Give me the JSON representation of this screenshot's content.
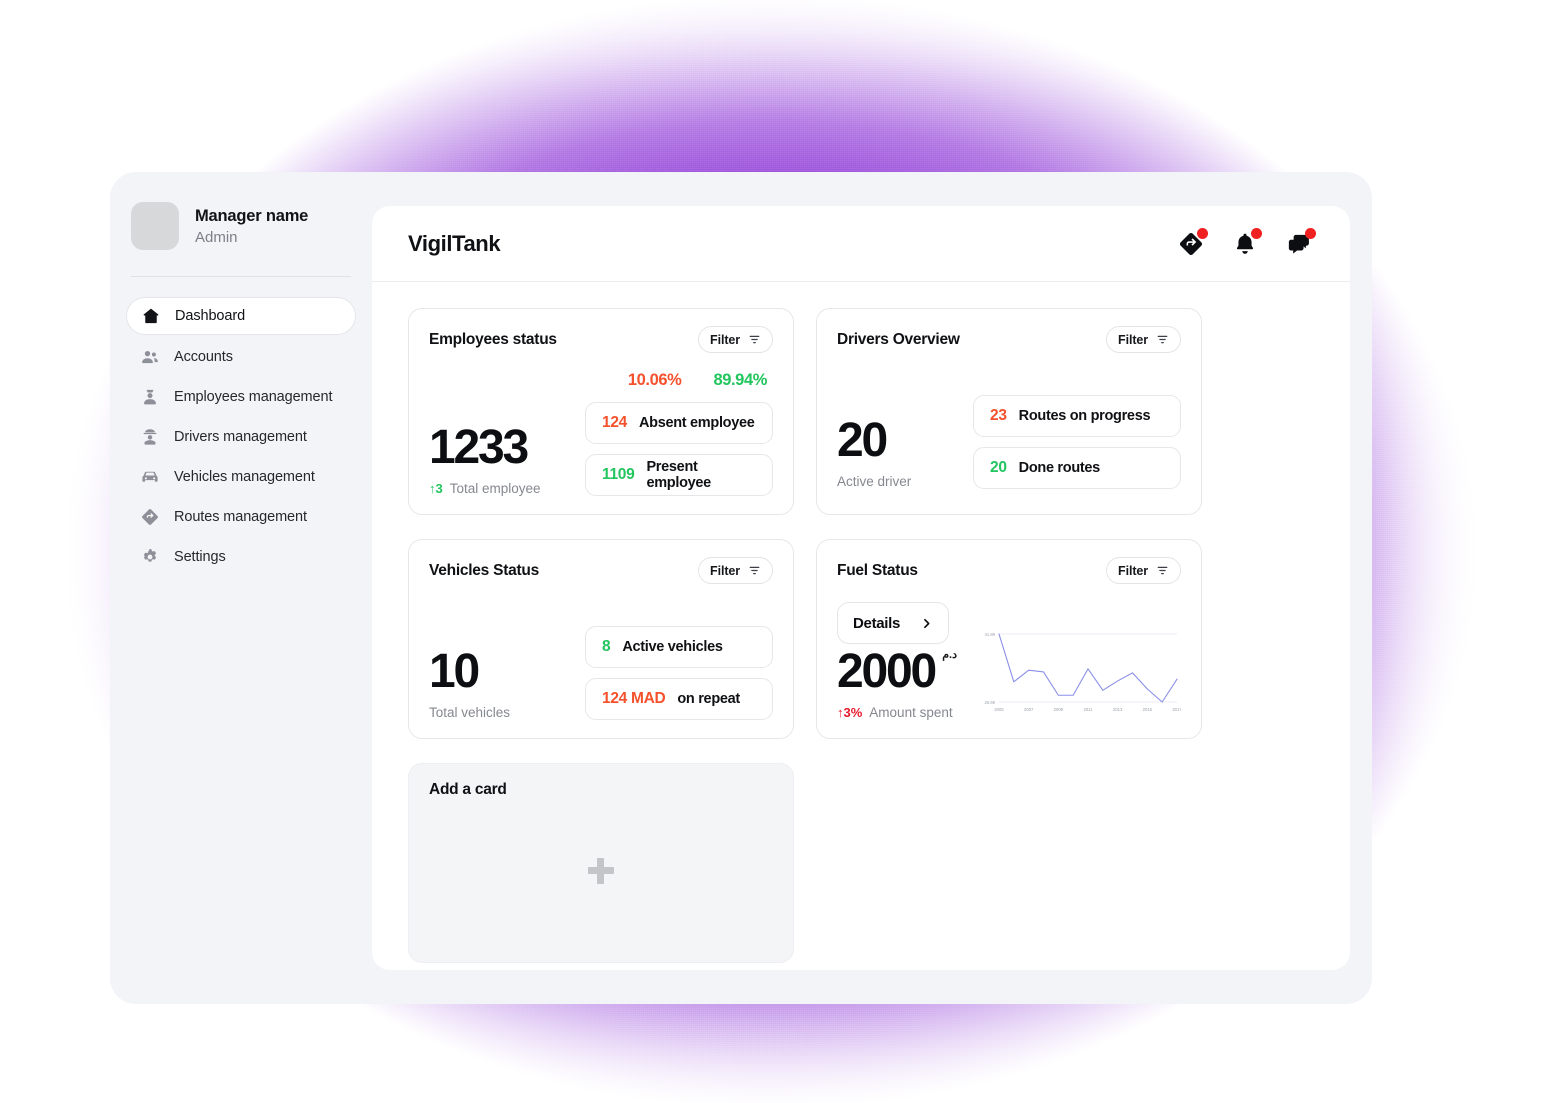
{
  "glow": {
    "color": "#8b33d6"
  },
  "sidebar": {
    "profile": {
      "name": "Manager name",
      "role": "Admin",
      "avatar_icon": "avatar-placeholder"
    },
    "items": [
      {
        "label": "Dashboard",
        "icon": "home-icon",
        "active": true
      },
      {
        "label": "Accounts",
        "icon": "people-icon",
        "active": false
      },
      {
        "label": "Employees management",
        "icon": "employee-badge-icon",
        "active": false
      },
      {
        "label": "Drivers management",
        "icon": "driver-cap-icon",
        "active": false
      },
      {
        "label": "Vehicles management",
        "icon": "car-icon",
        "active": false
      },
      {
        "label": "Routes management",
        "icon": "route-diamond-icon",
        "active": false
      },
      {
        "label": "Settings",
        "icon": "gear-icon",
        "active": false
      }
    ]
  },
  "topbar": {
    "brand": "VigilTank",
    "icons": [
      {
        "name": "routes-share-icon",
        "badge": true
      },
      {
        "name": "bell-icon",
        "badge": true
      },
      {
        "name": "chat-icon",
        "badge": true
      }
    ]
  },
  "filter_label": "Filter",
  "cards": {
    "employees": {
      "title": "Employees status",
      "filter": "Filter",
      "big_number": "1233",
      "delta": "↑3",
      "sub_label": "Total employee",
      "pct_absent": "10.06%",
      "pct_present": "89.94%",
      "absent": {
        "count": "124",
        "label": "Absent employee",
        "color": "#f4512c"
      },
      "present": {
        "count": "1109",
        "label": "Present employee",
        "color": "#22c55e"
      }
    },
    "drivers": {
      "title": "Drivers Overview",
      "filter": "Filter",
      "big_number": "20",
      "sub_label": "Active driver",
      "on_progress": {
        "count": "23",
        "label": "Routes on progress",
        "color": "#f4512c"
      },
      "done": {
        "count": "20",
        "label": "Done routes",
        "color": "#22c55e"
      }
    },
    "vehicles": {
      "title": "Vehicles Status",
      "filter": "Filter",
      "big_number": "10",
      "sub_label": "Total vehicles",
      "active": {
        "count": "8",
        "label": "Active vehicles",
        "color": "#22c55e"
      },
      "repeat": {
        "count": "124 MAD",
        "label": "on repeat",
        "color": "#f4512c"
      }
    },
    "fuel": {
      "title": "Fuel Status",
      "filter": "Filter",
      "details_label": "Details",
      "big_number": "2000",
      "currency": "د.م",
      "delta": "↑3%",
      "sub_label": "Amount spent"
    },
    "add": {
      "title": "Add a card",
      "plus_icon": "plus-icon"
    }
  },
  "chart_data": {
    "type": "line",
    "title": "Fuel Status",
    "xlabel": "",
    "ylabel": "",
    "x": [
      2005,
      2006,
      2007,
      2008,
      2009,
      2010,
      2011,
      2012,
      2013,
      2014,
      2015,
      2016,
      2017
    ],
    "values": [
      41.89,
      31.2,
      33.8,
      33.4,
      28.2,
      28.2,
      34.1,
      29.3,
      31.4,
      33.2,
      29.6,
      26.69,
      31.8
    ],
    "tick_labels_x": [
      "2005",
      "2007",
      "2009",
      "2011",
      "2013",
      "2015",
      "2017"
    ],
    "tick_labels_y": [
      "41.89",
      "26.69"
    ],
    "ylim": [
      26.69,
      41.89
    ],
    "xlim": [
      2005,
      2017
    ],
    "line_color": "#8b8fe8",
    "grid": true,
    "legend": false
  }
}
